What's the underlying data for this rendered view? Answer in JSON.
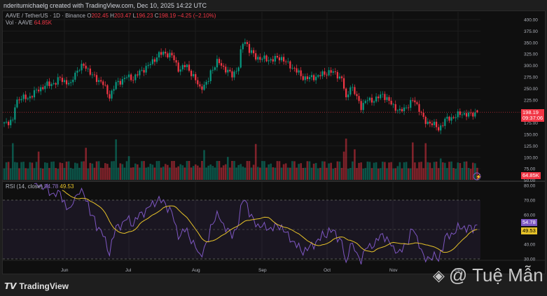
{
  "credit": "nderitumichaelg created with TradingView.com, Dec 10, 2025 14:22 UTC",
  "symbol_line": {
    "symbol": "AAVE / TetherUS · 1D · Binance",
    "o_label": "O",
    "o": "202.45",
    "h_label": "H",
    "h": "203.47",
    "l_label": "L",
    "l": "196.23",
    "c_label": "C",
    "c": "198.19",
    "change": "−4.25 (−2.10%)"
  },
  "volume_line": {
    "label": "Vol · AAVE",
    "value": "64.85K"
  },
  "rsi_line": {
    "label": "RSI (14, close)",
    "rsi": "54.78",
    "ma": "49.53"
  },
  "price_tag": {
    "price": "198.19",
    "countdown": "09:37:06"
  },
  "volume_tag": "64.85K",
  "rsi_tags": {
    "rsi": "54.78",
    "ma": "49.53"
  },
  "price_axis": [
    "400.00",
    "375.00",
    "350.00",
    "325.00",
    "300.00",
    "275.00",
    "250.00",
    "225.00",
    "175.00",
    "150.00",
    "125.00",
    "100.00",
    "75.00",
    "50.00"
  ],
  "rsi_axis": [
    "80.00",
    "70.00",
    "60.00",
    "40.00",
    "30.00"
  ],
  "time_axis": [
    "Jun",
    "Jul",
    "Aug",
    "Sep",
    "Oct",
    "Nov",
    "Dec"
  ],
  "footer": {
    "brand": "TradingView",
    "watermark": "@ Tuệ Mẫn"
  },
  "colors": {
    "up": "#089981",
    "down": "#f23645",
    "rsi": "#7e57c2",
    "rsi_ma": "#e6c229"
  },
  "chart_data": {
    "type": "candlestick",
    "title": "AAVE / TetherUS · 1D · Binance",
    "ylim": [
      50,
      400
    ],
    "rsi_ylim": [
      30,
      80
    ],
    "candles": 221,
    "close_waypoints": [
      [
        0,
        176
      ],
      [
        4,
        178
      ],
      [
        4.2,
        203
      ],
      [
        6.5,
        229
      ],
      [
        11,
        229
      ],
      [
        16,
        248
      ],
      [
        19.5,
        257
      ],
      [
        24,
        263
      ],
      [
        26,
        272
      ],
      [
        31,
        257
      ],
      [
        32.5,
        283
      ],
      [
        37.5,
        302
      ],
      [
        40.7,
        278
      ],
      [
        45.6,
        263
      ],
      [
        48.9,
        232
      ],
      [
        52,
        260
      ],
      [
        57,
        275
      ],
      [
        60,
        272
      ],
      [
        63.5,
        287
      ],
      [
        68.4,
        305
      ],
      [
        71.7,
        324
      ],
      [
        75,
        327
      ],
      [
        78,
        321
      ],
      [
        81.4,
        290
      ],
      [
        84.7,
        301
      ],
      [
        88,
        275
      ],
      [
        91,
        252
      ],
      [
        94.5,
        260
      ],
      [
        96,
        287
      ],
      [
        99.3,
        309
      ],
      [
        102,
        296
      ],
      [
        106,
        278
      ],
      [
        109,
        298
      ],
      [
        110.7,
        348
      ],
      [
        112.4,
        354
      ],
      [
        114,
        333
      ],
      [
        117,
        318
      ],
      [
        122,
        313
      ],
      [
        125,
        313
      ],
      [
        128.7,
        318
      ],
      [
        132,
        302
      ],
      [
        135,
        293
      ],
      [
        138.4,
        275
      ],
      [
        141.7,
        272
      ],
      [
        146.6,
        278
      ],
      [
        151.5,
        287
      ],
      [
        154.7,
        281
      ],
      [
        157.3,
        269
      ],
      [
        159,
        225
      ],
      [
        161,
        257
      ],
      [
        164.5,
        226
      ],
      [
        166,
        211
      ],
      [
        169,
        225
      ],
      [
        172.6,
        225
      ],
      [
        176,
        238
      ],
      [
        179,
        221
      ],
      [
        184,
        199
      ],
      [
        187,
        210
      ],
      [
        190.6,
        225
      ],
      [
        193.8,
        199
      ],
      [
        195.4,
        176
      ],
      [
        198.7,
        176
      ],
      [
        202,
        161
      ],
      [
        205,
        181
      ],
      [
        208.5,
        187
      ],
      [
        213,
        196
      ],
      [
        216.6,
        192
      ],
      [
        220,
        198.19
      ]
    ],
    "volume_spikes_k": [
      [
        4,
        480
      ],
      [
        16,
        370
      ],
      [
        38,
        420
      ],
      [
        52,
        530
      ],
      [
        58,
        310
      ],
      [
        93,
        390
      ],
      [
        104,
        300
      ],
      [
        117,
        470
      ],
      [
        158,
        370
      ],
      [
        159,
        540
      ],
      [
        163,
        400
      ],
      [
        183,
        180
      ],
      [
        190,
        490
      ],
      [
        196,
        480
      ],
      [
        203,
        280
      ]
    ]
  }
}
